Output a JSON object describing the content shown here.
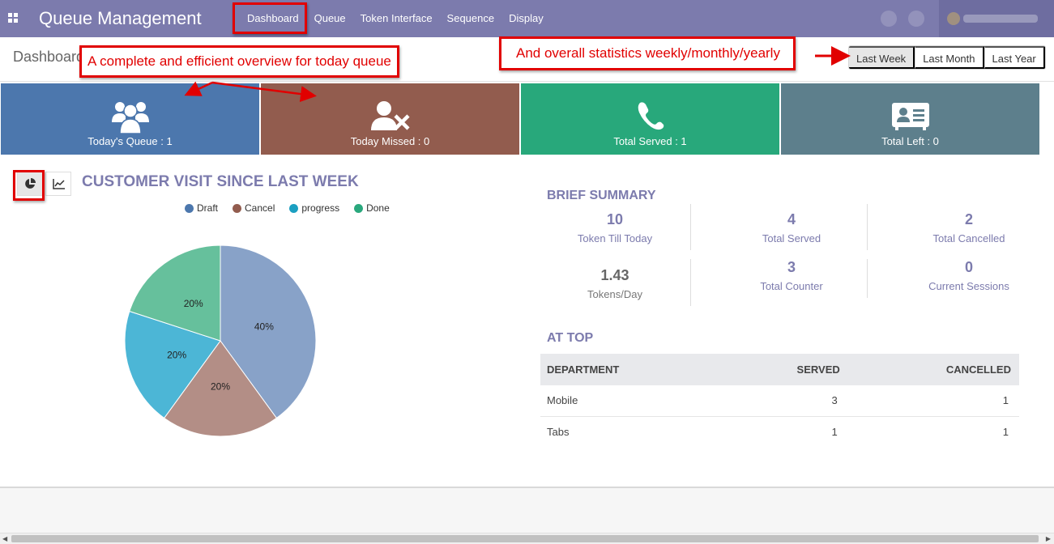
{
  "navbar": {
    "app_title": "Queue Management",
    "menu": [
      "Dashboard",
      "Queue",
      "Token Interface",
      "Sequence",
      "Display"
    ],
    "active_menu": "Dashboard"
  },
  "breadcrumb": "Dashboard",
  "period_filters": [
    "Last Week",
    "Last Month",
    "Last Year"
  ],
  "active_period": "Last Week",
  "kpis": [
    {
      "label": "Today's Queue : 1",
      "color": "#4c77ad",
      "icon": "users-icon"
    },
    {
      "label": "Today Missed : 0",
      "color": "#925c4e",
      "icon": "user-times-icon"
    },
    {
      "label": "Total Served : 1",
      "color": "#28a87b",
      "icon": "phone-icon"
    },
    {
      "label": "Total Left : 0",
      "color": "#5d7f8c",
      "icon": "address-card-icon"
    }
  ],
  "chart": {
    "title": "CUSTOMER VISIT SINCE LAST WEEK",
    "toggles": [
      "pie-chart-icon",
      "line-chart-icon"
    ],
    "active_toggle": "pie-chart-icon"
  },
  "chart_data": {
    "type": "pie",
    "title": "CUSTOMER VISIT SINCE LAST WEEK",
    "legend_position": "top",
    "legend": [
      "Draft",
      "Cancel",
      "progress",
      "Done"
    ],
    "slices": [
      {
        "name": "Draft",
        "value": 40,
        "label": "40%",
        "color": "#88a2c8"
      },
      {
        "name": "Cancel",
        "value": 20,
        "label": "20%",
        "color": "#b38e86"
      },
      {
        "name": "progress",
        "value": 20,
        "label": "20%",
        "color": "#4cb6d6"
      },
      {
        "name": "Done",
        "value": 20,
        "label": "20%",
        "color": "#66c09c"
      }
    ]
  },
  "legend_colors": [
    "#4c77ad",
    "#925c4e",
    "#1b9fc1",
    "#2aa87d"
  ],
  "summary": {
    "title": "BRIEF SUMMARY",
    "stats": [
      {
        "value": "10",
        "label": "Token Till Today"
      },
      {
        "value": "4",
        "label": "Total Served"
      },
      {
        "value": "2",
        "label": "Total Cancelled"
      },
      {
        "value": "1.43",
        "label": "Tokens/Day"
      },
      {
        "value": "3",
        "label": "Total Counter"
      },
      {
        "value": "0",
        "label": "Current Sessions"
      }
    ]
  },
  "at_top": {
    "title": "AT TOP",
    "headers": [
      "DEPARTMENT",
      "SERVED",
      "CANCELLED"
    ],
    "rows": [
      [
        "Mobile",
        "3",
        "1"
      ],
      [
        "Tabs",
        "1",
        "1"
      ]
    ]
  },
  "annotations": {
    "today": "A complete and efficient overview for today queue",
    "stats": "And overall statistics weekly/monthly/yearly"
  }
}
